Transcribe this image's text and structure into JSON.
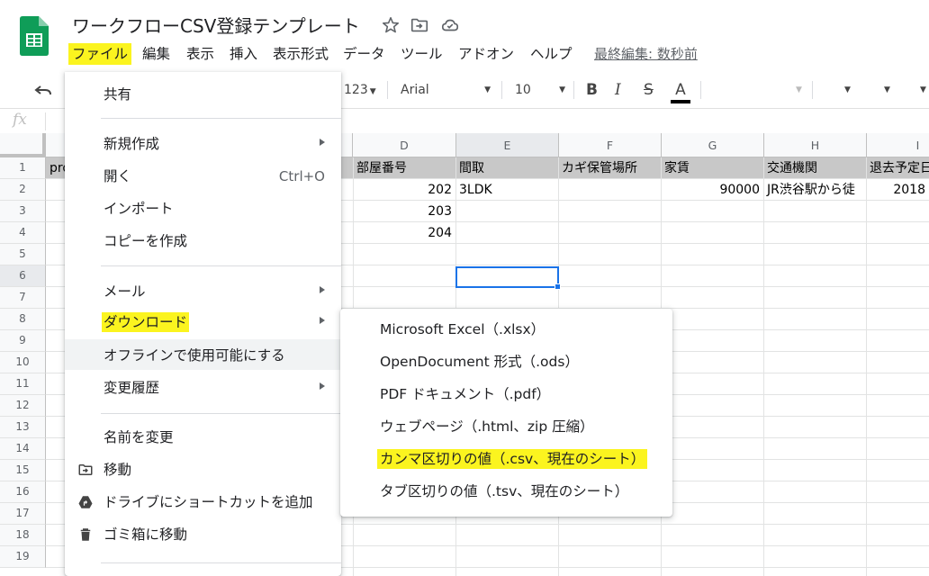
{
  "doc": {
    "title": "ワークフローCSV登録テンプレート",
    "last_edit": "最終編集: 数秒前"
  },
  "menubar": {
    "items": [
      "ファイル",
      "編集",
      "表示",
      "挿入",
      "表示形式",
      "データ",
      "ツール",
      "アドオン",
      "ヘルプ"
    ]
  },
  "toolbar": {
    "number_format": "123",
    "font": "Arial",
    "font_size": "10",
    "bold": "B",
    "italic": "I",
    "strike": "S",
    "text_color": "A"
  },
  "formula_bar": {
    "fx": "fx",
    "value": ""
  },
  "grid": {
    "columns": [
      "D",
      "E",
      "F",
      "G",
      "H",
      "I"
    ],
    "selected_column": "E",
    "rows": [
      "1",
      "2",
      "3",
      "4",
      "5",
      "6",
      "7",
      "8",
      "9",
      "10",
      "11",
      "12",
      "13",
      "14",
      "15",
      "16",
      "17",
      "18",
      "19"
    ],
    "selected_row": "6",
    "cells": {
      "a1": "pro",
      "d1": "部屋番号",
      "e1": "間取",
      "f1": "カギ保管場所",
      "g1": "家賃",
      "h1": "交通機関",
      "i1": "退去予定日",
      "d2": "202",
      "e2": "3LDK",
      "g2": "90000",
      "h2": "JR渋谷駅から徒",
      "i2": "2018",
      "d3": "203",
      "d4": "204"
    }
  },
  "file_menu": {
    "share": "共有",
    "new": "新規作成",
    "open": "開く",
    "open_shortcut": "Ctrl+O",
    "import": "インポート",
    "copy": "コピーを作成",
    "email": "メール",
    "download": "ダウンロード",
    "offline": "オフラインで使用可能にする",
    "history": "変更履歴",
    "rename": "名前を変更",
    "move": "移動",
    "add_shortcut": "ドライブにショートカットを追加",
    "trash": "ゴミ箱に移動"
  },
  "download_menu": {
    "items": [
      "Microsoft Excel（.xlsx）",
      "OpenDocument 形式（.ods）",
      "PDF ドキュメント（.pdf）",
      "ウェブページ（.html、zip 圧縮）",
      "カンマ区切りの値（.csv、現在のシート）",
      "タブ区切りの値（.tsv、現在のシート）"
    ]
  },
  "colors": {
    "highlight": "#fbf41f",
    "sheets_green": "#0f9d58",
    "selection_blue": "#1a73e8",
    "header_row_gray": "#c8c8c8"
  }
}
